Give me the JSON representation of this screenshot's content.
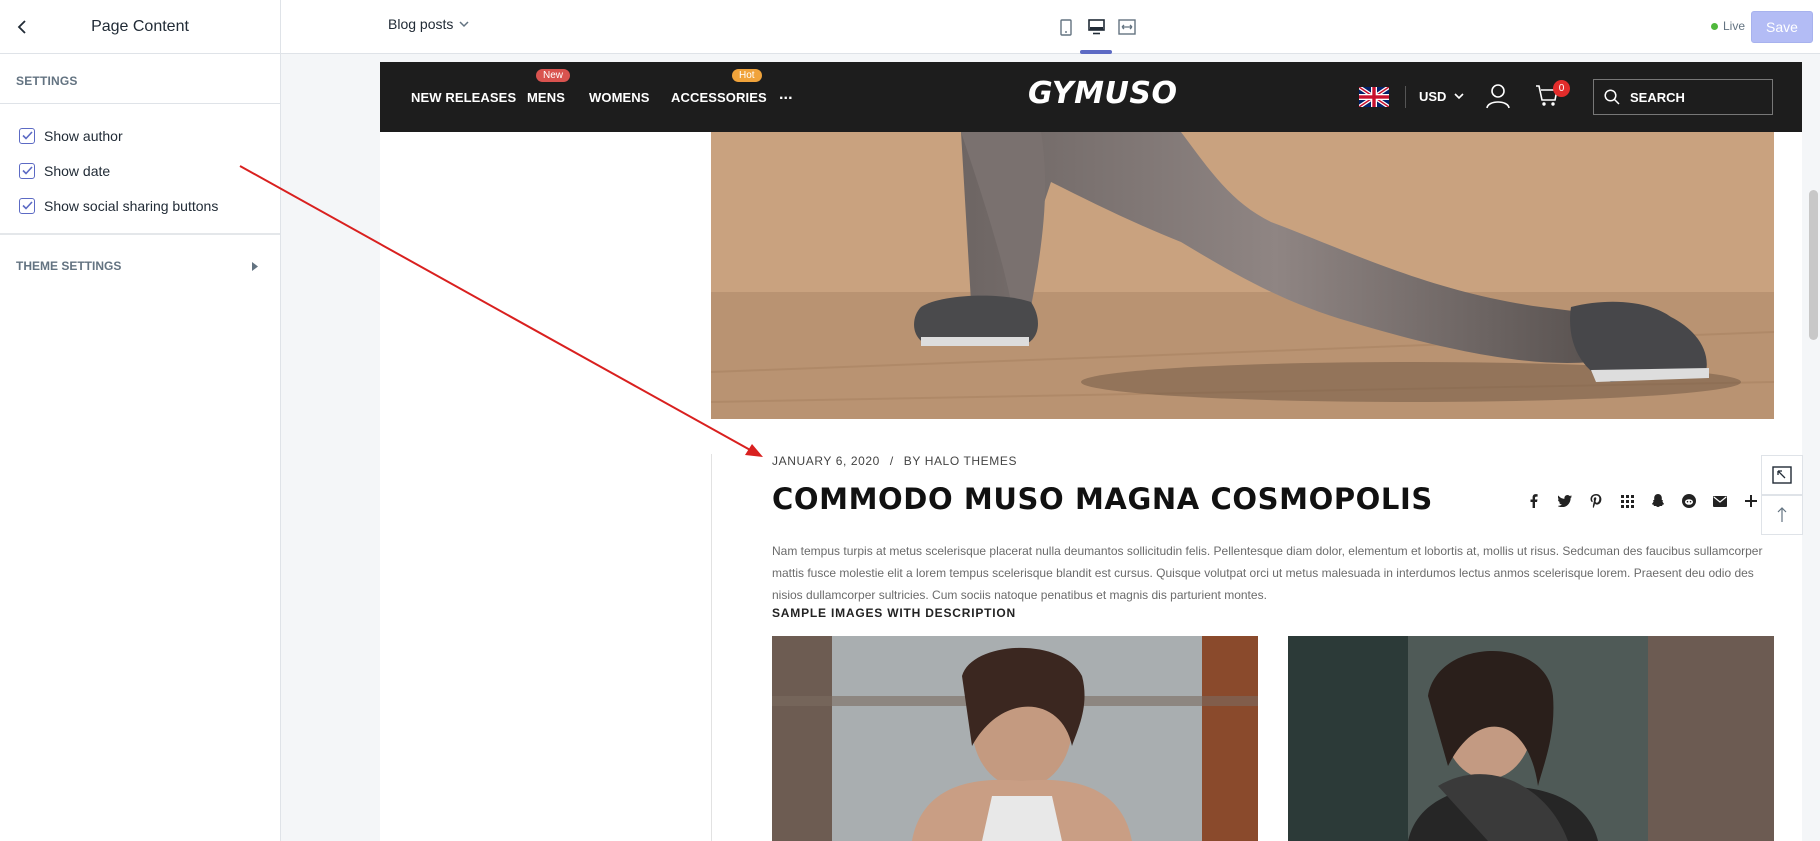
{
  "sidebar": {
    "title": "Page Content",
    "section_label": "SETTINGS",
    "checkboxes": [
      {
        "label": "Show author",
        "checked": true
      },
      {
        "label": "Show date",
        "checked": true
      },
      {
        "label": "Show social sharing buttons",
        "checked": true
      }
    ],
    "theme_settings_label": "THEME SETTINGS"
  },
  "topbar": {
    "page_selector": "Blog posts",
    "views": [
      "mobile-view-icon",
      "desktop-view-icon",
      "full-width-view-icon"
    ],
    "active_view": "desktop",
    "status": "Live",
    "save_label": "Save"
  },
  "store": {
    "nav": [
      {
        "label": "NEW RELEASES",
        "badge": ""
      },
      {
        "label": "MENS",
        "badge": "New"
      },
      {
        "label": "WOMENS",
        "badge": ""
      },
      {
        "label": "ACCESSORIES",
        "badge": "Hot"
      },
      {
        "label": "...",
        "badge": ""
      }
    ],
    "badge_colors": {
      "New": "#d9534f",
      "Hot": "#f0a33b"
    },
    "logo": "GYMUSO",
    "currency": "USD",
    "cart_count": "0",
    "search_placeholder": "SEARCH"
  },
  "article": {
    "date": "JANUARY 6, 2020",
    "separator": "/",
    "author": "BY HALO THEMES",
    "title": "COMMODO MUSO MAGNA COSMOPOLIS",
    "share_icons": [
      "facebook-icon",
      "twitter-icon",
      "pinterest-icon",
      "tumblr-icon",
      "snapchat-icon",
      "reddit-icon",
      "email-icon",
      "plus-icon"
    ],
    "body": "Nam tempus turpis at metus scelerisque placerat nulla deumantos sollicitudin felis. Pellentesque diam dolor, elementum et lobortis at, mollis ut risus. Sedcuman des faucibus sullamcorper mattis fusce molestie elit a lorem tempus scelerisque blandit est cursus. Quisque volutpat orci ut metus malesuada in interdumos lectus anmos scelerisque lorem. Praesent deu odio des nisios dullamcorper sultricies. Cum sociis natoque penatibus et magnis dis parturient montes.",
    "subheading": "SAMPLE IMAGES WITH DESCRIPTION"
  },
  "colors": {
    "accent": "#5c6ac4",
    "save_button": "#b3bcf5",
    "header_bg": "#1d1d1d",
    "annotation_arrow": "#d9201f"
  }
}
